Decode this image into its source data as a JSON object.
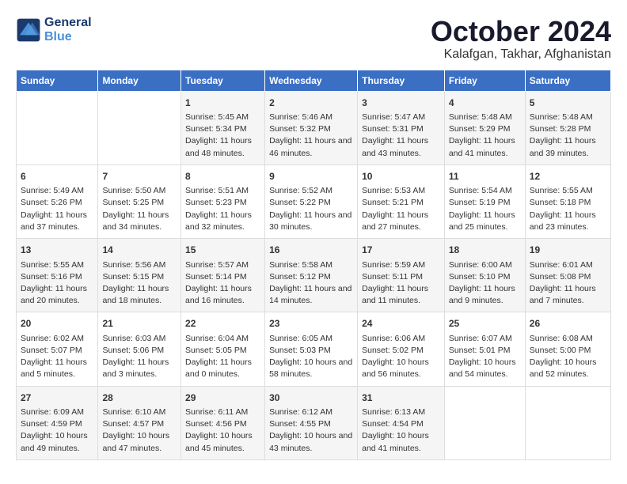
{
  "logo": {
    "line1": "General",
    "line2": "Blue"
  },
  "title": "October 2024",
  "subtitle": "Kalafgan, Takhar, Afghanistan",
  "days_of_week": [
    "Sunday",
    "Monday",
    "Tuesday",
    "Wednesday",
    "Thursday",
    "Friday",
    "Saturday"
  ],
  "weeks": [
    [
      {
        "day": "",
        "sunrise": "",
        "sunset": "",
        "daylight": ""
      },
      {
        "day": "",
        "sunrise": "",
        "sunset": "",
        "daylight": ""
      },
      {
        "day": "1",
        "sunrise": "Sunrise: 5:45 AM",
        "sunset": "Sunset: 5:34 PM",
        "daylight": "Daylight: 11 hours and 48 minutes."
      },
      {
        "day": "2",
        "sunrise": "Sunrise: 5:46 AM",
        "sunset": "Sunset: 5:32 PM",
        "daylight": "Daylight: 11 hours and 46 minutes."
      },
      {
        "day": "3",
        "sunrise": "Sunrise: 5:47 AM",
        "sunset": "Sunset: 5:31 PM",
        "daylight": "Daylight: 11 hours and 43 minutes."
      },
      {
        "day": "4",
        "sunrise": "Sunrise: 5:48 AM",
        "sunset": "Sunset: 5:29 PM",
        "daylight": "Daylight: 11 hours and 41 minutes."
      },
      {
        "day": "5",
        "sunrise": "Sunrise: 5:48 AM",
        "sunset": "Sunset: 5:28 PM",
        "daylight": "Daylight: 11 hours and 39 minutes."
      }
    ],
    [
      {
        "day": "6",
        "sunrise": "Sunrise: 5:49 AM",
        "sunset": "Sunset: 5:26 PM",
        "daylight": "Daylight: 11 hours and 37 minutes."
      },
      {
        "day": "7",
        "sunrise": "Sunrise: 5:50 AM",
        "sunset": "Sunset: 5:25 PM",
        "daylight": "Daylight: 11 hours and 34 minutes."
      },
      {
        "day": "8",
        "sunrise": "Sunrise: 5:51 AM",
        "sunset": "Sunset: 5:23 PM",
        "daylight": "Daylight: 11 hours and 32 minutes."
      },
      {
        "day": "9",
        "sunrise": "Sunrise: 5:52 AM",
        "sunset": "Sunset: 5:22 PM",
        "daylight": "Daylight: 11 hours and 30 minutes."
      },
      {
        "day": "10",
        "sunrise": "Sunrise: 5:53 AM",
        "sunset": "Sunset: 5:21 PM",
        "daylight": "Daylight: 11 hours and 27 minutes."
      },
      {
        "day": "11",
        "sunrise": "Sunrise: 5:54 AM",
        "sunset": "Sunset: 5:19 PM",
        "daylight": "Daylight: 11 hours and 25 minutes."
      },
      {
        "day": "12",
        "sunrise": "Sunrise: 5:55 AM",
        "sunset": "Sunset: 5:18 PM",
        "daylight": "Daylight: 11 hours and 23 minutes."
      }
    ],
    [
      {
        "day": "13",
        "sunrise": "Sunrise: 5:55 AM",
        "sunset": "Sunset: 5:16 PM",
        "daylight": "Daylight: 11 hours and 20 minutes."
      },
      {
        "day": "14",
        "sunrise": "Sunrise: 5:56 AM",
        "sunset": "Sunset: 5:15 PM",
        "daylight": "Daylight: 11 hours and 18 minutes."
      },
      {
        "day": "15",
        "sunrise": "Sunrise: 5:57 AM",
        "sunset": "Sunset: 5:14 PM",
        "daylight": "Daylight: 11 hours and 16 minutes."
      },
      {
        "day": "16",
        "sunrise": "Sunrise: 5:58 AM",
        "sunset": "Sunset: 5:12 PM",
        "daylight": "Daylight: 11 hours and 14 minutes."
      },
      {
        "day": "17",
        "sunrise": "Sunrise: 5:59 AM",
        "sunset": "Sunset: 5:11 PM",
        "daylight": "Daylight: 11 hours and 11 minutes."
      },
      {
        "day": "18",
        "sunrise": "Sunrise: 6:00 AM",
        "sunset": "Sunset: 5:10 PM",
        "daylight": "Daylight: 11 hours and 9 minutes."
      },
      {
        "day": "19",
        "sunrise": "Sunrise: 6:01 AM",
        "sunset": "Sunset: 5:08 PM",
        "daylight": "Daylight: 11 hours and 7 minutes."
      }
    ],
    [
      {
        "day": "20",
        "sunrise": "Sunrise: 6:02 AM",
        "sunset": "Sunset: 5:07 PM",
        "daylight": "Daylight: 11 hours and 5 minutes."
      },
      {
        "day": "21",
        "sunrise": "Sunrise: 6:03 AM",
        "sunset": "Sunset: 5:06 PM",
        "daylight": "Daylight: 11 hours and 3 minutes."
      },
      {
        "day": "22",
        "sunrise": "Sunrise: 6:04 AM",
        "sunset": "Sunset: 5:05 PM",
        "daylight": "Daylight: 11 hours and 0 minutes."
      },
      {
        "day": "23",
        "sunrise": "Sunrise: 6:05 AM",
        "sunset": "Sunset: 5:03 PM",
        "daylight": "Daylight: 10 hours and 58 minutes."
      },
      {
        "day": "24",
        "sunrise": "Sunrise: 6:06 AM",
        "sunset": "Sunset: 5:02 PM",
        "daylight": "Daylight: 10 hours and 56 minutes."
      },
      {
        "day": "25",
        "sunrise": "Sunrise: 6:07 AM",
        "sunset": "Sunset: 5:01 PM",
        "daylight": "Daylight: 10 hours and 54 minutes."
      },
      {
        "day": "26",
        "sunrise": "Sunrise: 6:08 AM",
        "sunset": "Sunset: 5:00 PM",
        "daylight": "Daylight: 10 hours and 52 minutes."
      }
    ],
    [
      {
        "day": "27",
        "sunrise": "Sunrise: 6:09 AM",
        "sunset": "Sunset: 4:59 PM",
        "daylight": "Daylight: 10 hours and 49 minutes."
      },
      {
        "day": "28",
        "sunrise": "Sunrise: 6:10 AM",
        "sunset": "Sunset: 4:57 PM",
        "daylight": "Daylight: 10 hours and 47 minutes."
      },
      {
        "day": "29",
        "sunrise": "Sunrise: 6:11 AM",
        "sunset": "Sunset: 4:56 PM",
        "daylight": "Daylight: 10 hours and 45 minutes."
      },
      {
        "day": "30",
        "sunrise": "Sunrise: 6:12 AM",
        "sunset": "Sunset: 4:55 PM",
        "daylight": "Daylight: 10 hours and 43 minutes."
      },
      {
        "day": "31",
        "sunrise": "Sunrise: 6:13 AM",
        "sunset": "Sunset: 4:54 PM",
        "daylight": "Daylight: 10 hours and 41 minutes."
      },
      {
        "day": "",
        "sunrise": "",
        "sunset": "",
        "daylight": ""
      },
      {
        "day": "",
        "sunrise": "",
        "sunset": "",
        "daylight": ""
      }
    ]
  ]
}
